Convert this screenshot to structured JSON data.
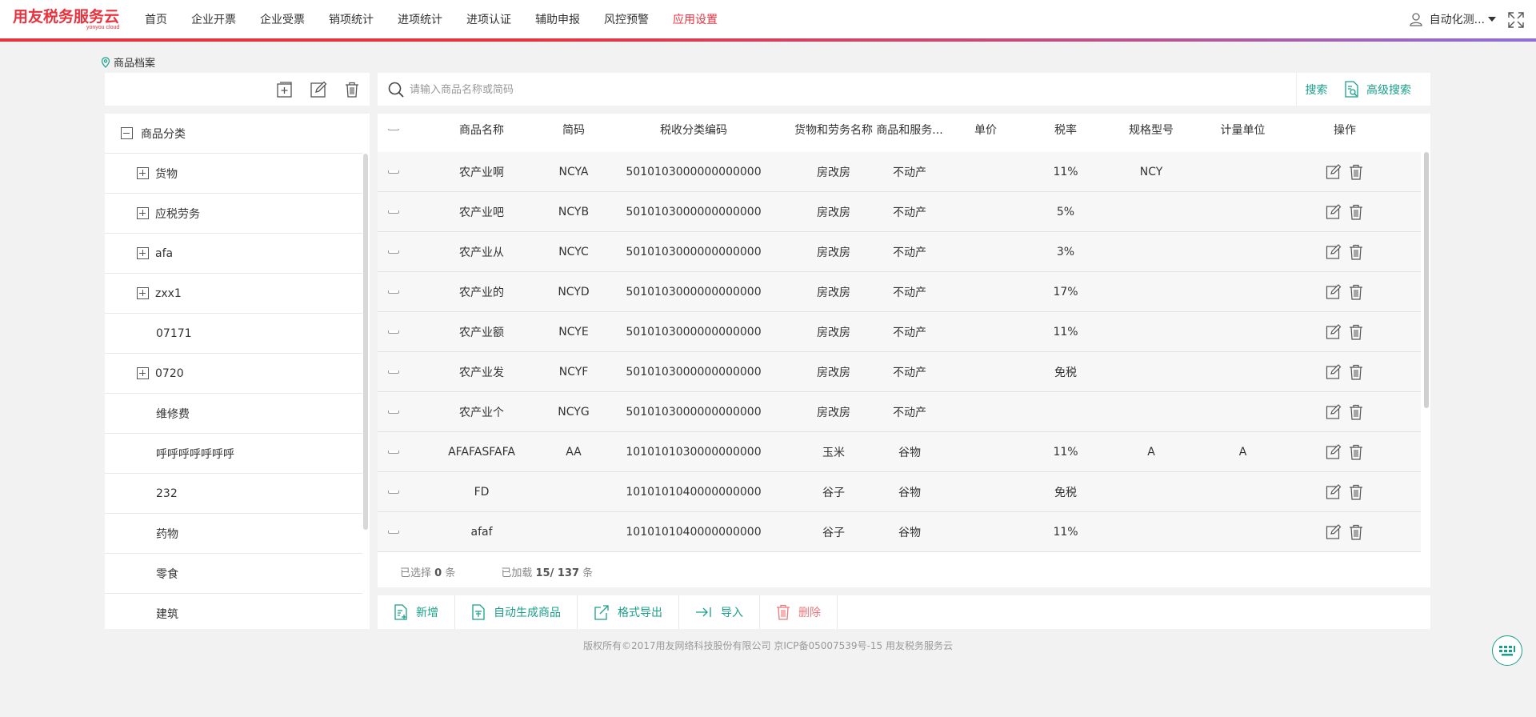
{
  "app": {
    "logo_text": "用友税务服务云",
    "logo_sub": "yonyou cloud"
  },
  "nav": {
    "items": [
      {
        "label": "首页"
      },
      {
        "label": "企业开票"
      },
      {
        "label": "企业受票"
      },
      {
        "label": "销项统计"
      },
      {
        "label": "进项统计"
      },
      {
        "label": "进项认证"
      },
      {
        "label": "辅助申报"
      },
      {
        "label": "风控预警"
      },
      {
        "label": "应用设置"
      }
    ],
    "active": "应用设置",
    "accent_color": "#e8333f"
  },
  "user": {
    "name": "自动化测..."
  },
  "breadcrumb": {
    "label": "商品档案"
  },
  "tree": {
    "root_label": "商品分类",
    "items": [
      {
        "label": "货物",
        "expandable": true
      },
      {
        "label": "应税劳务",
        "expandable": true
      },
      {
        "label": "afa",
        "expandable": true
      },
      {
        "label": "zxx1",
        "expandable": true
      },
      {
        "label": "07171",
        "expandable": false
      },
      {
        "label": "0720",
        "expandable": true
      },
      {
        "label": "维修费",
        "expandable": false
      },
      {
        "label": "呼呼呼呼呼呼呼",
        "expandable": false
      },
      {
        "label": "232",
        "expandable": false
      },
      {
        "label": "药物",
        "expandable": false
      },
      {
        "label": "零食",
        "expandable": false
      },
      {
        "label": "建筑",
        "expandable": false
      }
    ]
  },
  "search": {
    "placeholder": "请输入商品名称或简码",
    "search_label": "搜索",
    "advanced_label": "高级搜索"
  },
  "table": {
    "columns": [
      "商品名称",
      "简码",
      "税收分类编码",
      "货物和劳务名称",
      "商品和服务...",
      "单价",
      "税率",
      "规格型号",
      "计量单位",
      "操作"
    ],
    "rows": [
      {
        "name": "农产业啊",
        "code": "NCYA",
        "tax_code": "5010103000000000000",
        "goods": "房改房",
        "service": "不动产",
        "price": "",
        "rate": "11%",
        "spec": "NCY",
        "unit": ""
      },
      {
        "name": "农产业吧",
        "code": "NCYB",
        "tax_code": "5010103000000000000",
        "goods": "房改房",
        "service": "不动产",
        "price": "",
        "rate": "5%",
        "spec": "",
        "unit": ""
      },
      {
        "name": "农产业从",
        "code": "NCYC",
        "tax_code": "5010103000000000000",
        "goods": "房改房",
        "service": "不动产",
        "price": "",
        "rate": "3%",
        "spec": "",
        "unit": ""
      },
      {
        "name": "农产业的",
        "code": "NCYD",
        "tax_code": "5010103000000000000",
        "goods": "房改房",
        "service": "不动产",
        "price": "",
        "rate": "17%",
        "spec": "",
        "unit": ""
      },
      {
        "name": "农产业额",
        "code": "NCYE",
        "tax_code": "5010103000000000000",
        "goods": "房改房",
        "service": "不动产",
        "price": "",
        "rate": "11%",
        "spec": "",
        "unit": ""
      },
      {
        "name": "农产业发",
        "code": "NCYF",
        "tax_code": "5010103000000000000",
        "goods": "房改房",
        "service": "不动产",
        "price": "",
        "rate": "免税",
        "spec": "",
        "unit": ""
      },
      {
        "name": "农产业个",
        "code": "NCYG",
        "tax_code": "5010103000000000000",
        "goods": "房改房",
        "service": "不动产",
        "price": "",
        "rate": "",
        "spec": "",
        "unit": ""
      },
      {
        "name": "AFAFASFAFA",
        "code": "AA",
        "tax_code": "1010101030000000000",
        "goods": "玉米",
        "service": "谷物",
        "price": "",
        "rate": "11%",
        "spec": "A",
        "unit": "A"
      },
      {
        "name": "FD",
        "code": "",
        "tax_code": "1010101040000000000",
        "goods": "谷子",
        "service": "谷物",
        "price": "",
        "rate": "免税",
        "spec": "",
        "unit": ""
      },
      {
        "name": "afaf",
        "code": "",
        "tax_code": "1010101040000000000",
        "goods": "谷子",
        "service": "谷物",
        "price": "",
        "rate": "11%",
        "spec": "",
        "unit": ""
      }
    ],
    "footer": {
      "selected_prefix": "已选择",
      "selected_count": "0",
      "selected_suffix": "条",
      "loaded_prefix": "已加载",
      "loaded_count": "15/ 137",
      "loaded_suffix": "条"
    }
  },
  "actions": [
    {
      "label": "新增",
      "icon": "add-doc-icon"
    },
    {
      "label": "自动生成商品",
      "icon": "auto-generate-icon"
    },
    {
      "label": "格式导出",
      "icon": "export-icon"
    },
    {
      "label": "导入",
      "icon": "import-icon"
    },
    {
      "label": "删除",
      "icon": "trash-icon"
    }
  ],
  "footer": {
    "copyright": "版权所有©2017用友网络科技股份有限公司  京ICP备05007539号-15  用友税务服务云"
  },
  "colors": {
    "accent_green": "#1aa08a",
    "brand_red": "#e8333f",
    "delete_red": "#f0767a"
  }
}
